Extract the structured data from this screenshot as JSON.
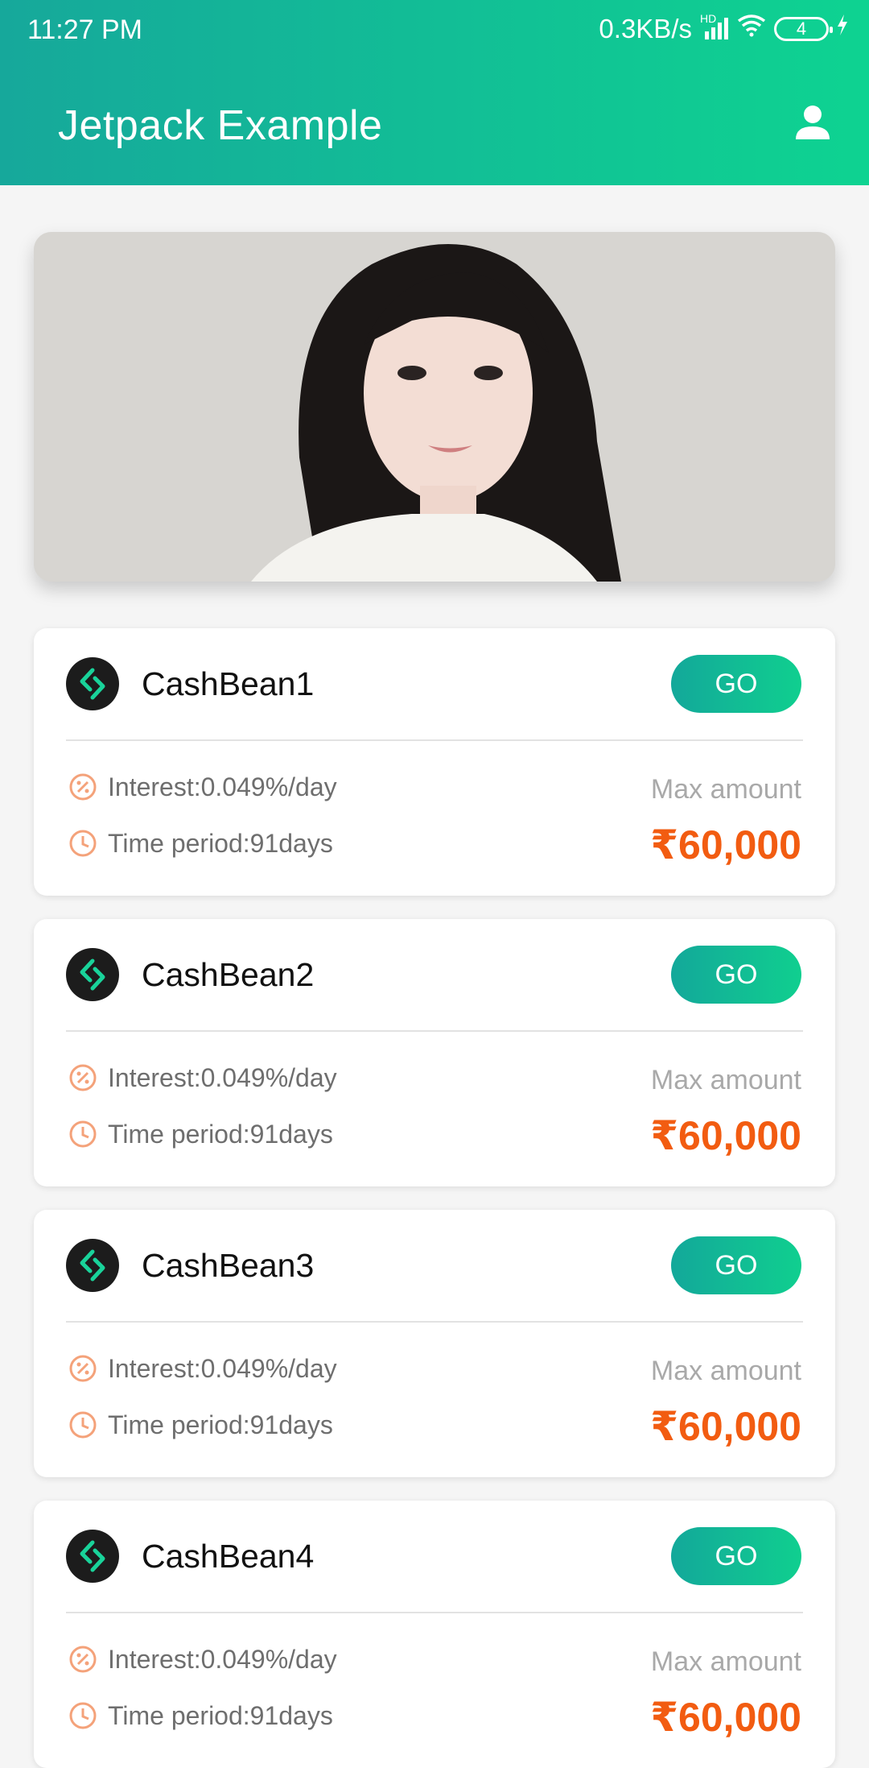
{
  "status_bar": {
    "time": "11:27 PM",
    "speed": "0.3KB/s",
    "network_badge": "HD",
    "battery_level": "4"
  },
  "app_bar": {
    "title": "Jetpack Example",
    "profile_icon": "person-icon"
  },
  "banner": {
    "image_icon": "portrait-photo"
  },
  "colors": {
    "accent_start": "#16a89b",
    "accent_end": "#0ed391",
    "amount_color": "#f25c11",
    "info_icon_color": "#f4a27a"
  },
  "cards": [
    {
      "name": "CashBean1",
      "go_label": "GO",
      "interest": "Interest:0.049%/day",
      "period": "Time period:91days",
      "max_label": "Max amount",
      "amount": "₹60,000"
    },
    {
      "name": "CashBean2",
      "go_label": "GO",
      "interest": "Interest:0.049%/day",
      "period": "Time period:91days",
      "max_label": "Max amount",
      "amount": "₹60,000"
    },
    {
      "name": "CashBean3",
      "go_label": "GO",
      "interest": "Interest:0.049%/day",
      "period": "Time period:91days",
      "max_label": "Max amount",
      "amount": "₹60,000"
    },
    {
      "name": "CashBean4",
      "go_label": "GO",
      "interest": "Interest:0.049%/day",
      "period": "Time period:91days",
      "max_label": "Max amount",
      "amount": "₹60,000"
    }
  ]
}
